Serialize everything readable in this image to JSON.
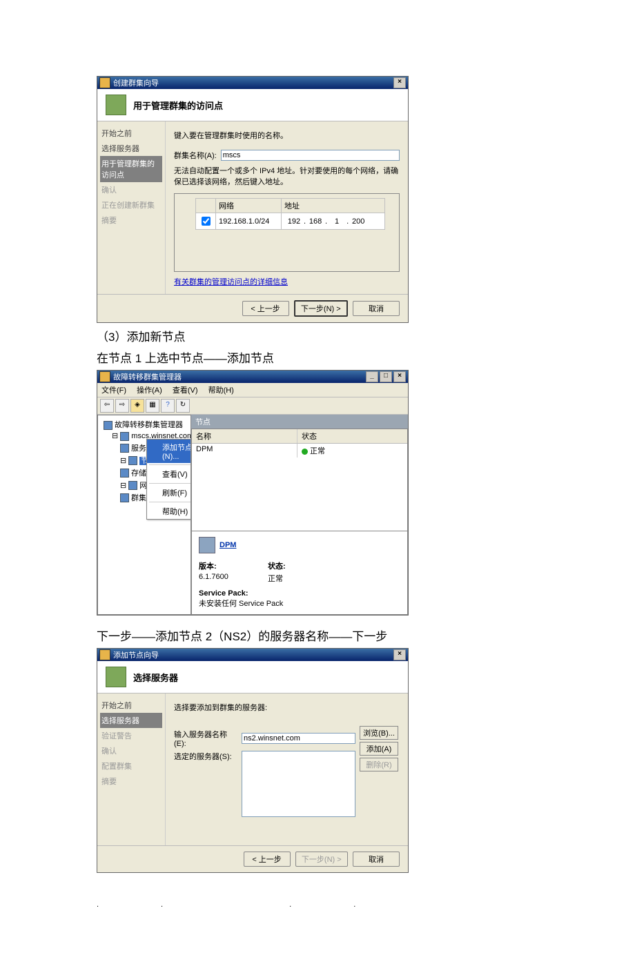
{
  "wizard1": {
    "title": "创建群集向导",
    "header": "用于管理群集的访问点",
    "steps": [
      "开始之前",
      "选择服务器",
      "用于管理群集的访问点",
      "确认",
      "正在创建新群集",
      "摘要"
    ],
    "instruction": "键入要在管理群集时使用的名称。",
    "name_label": "群集名称(A):",
    "name_value": "mscs",
    "auto_info": "无法自动配置一个或多个 IPv4 地址。针对要使用的每个网络，请确保已选择该网络，然后键入地址。",
    "grid_cols": [
      "",
      "网络",
      "地址"
    ],
    "grid_row": {
      "checked": true,
      "network": "192.168.1.0/24",
      "ip": [
        "192",
        "168",
        "1",
        "200"
      ]
    },
    "link": "有关群集的管理访问点的详细信息",
    "btn_prev": "< 上一步",
    "btn_next": "下一步(N) >",
    "btn_cancel": "取消"
  },
  "doc": {
    "line1": "（3）添加新节点",
    "line2": "在节点 1 上选中节点——添加节点",
    "line3": "下一步——添加节点 2（NS2）的服务器名称——下一步"
  },
  "mgr": {
    "title": "故障转移群集管理器",
    "menus": [
      "文件(F)",
      "操作(A)",
      "查看(V)",
      "帮助(H)"
    ],
    "tree": {
      "root": "故障转移群集管理器",
      "cluster": "mscs.winsnet.com",
      "svc": "服务和应用程序",
      "nodes": "节点",
      "storage": "存储",
      "net": "网络",
      "events": "群集事件"
    },
    "ctx": {
      "add": "添加节点(N)...",
      "view": "查看(V)",
      "refresh": "刷新(F)",
      "help": "帮助(H)"
    },
    "section": "节点",
    "list_headers": [
      "名称",
      "状态"
    ],
    "list_row": {
      "name": "DPM",
      "status": "正常"
    },
    "detail": {
      "name": "DPM",
      "version_lbl": "版本:",
      "version_val": "6.1.7600",
      "status_lbl": "状态:",
      "status_val": "正常",
      "sp_lbl": "Service Pack:",
      "sp_val": "未安装任何 Service Pack"
    }
  },
  "wizard2": {
    "title": "添加节点向导",
    "header": "选择服务器",
    "steps": [
      "开始之前",
      "选择服务器",
      "验证警告",
      "确认",
      "配置群集",
      "摘要"
    ],
    "instruction": "选择要添加到群集的服务器:",
    "server_name_lbl": "输入服务器名称(E):",
    "server_name_val": "ns2.winsnet.com",
    "selected_lbl": "选定的服务器(S):",
    "btn_browse": "浏览(B)...",
    "btn_add": "添加(A)",
    "btn_remove": "删除(R)",
    "btn_prev": "< 上一步",
    "btn_next": "下一步(N) >",
    "btn_cancel": "取消"
  },
  "footer": ".. .."
}
